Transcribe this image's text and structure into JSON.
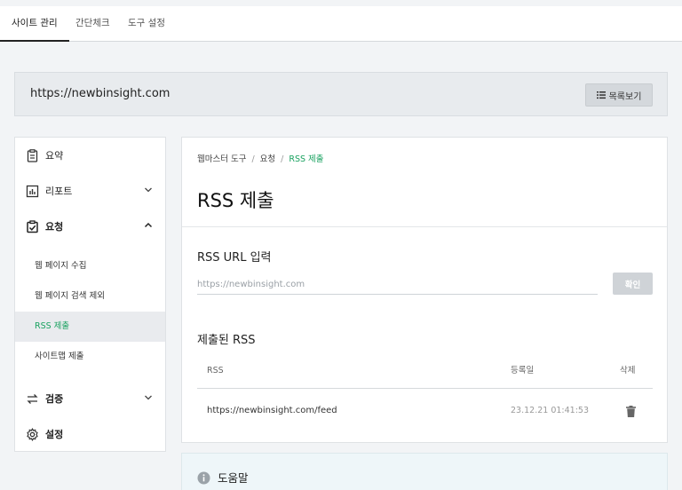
{
  "tabs": [
    {
      "label": "사이트 관리",
      "active": true
    },
    {
      "label": "간단체크",
      "active": false
    },
    {
      "label": "도구 설정",
      "active": false
    }
  ],
  "site": {
    "url": "https://newbinsight.com",
    "list_button": "목록보기"
  },
  "sidebar": {
    "items": [
      {
        "label": "요약",
        "icon": "clipboard-icon"
      },
      {
        "label": "리포트",
        "icon": "bar-chart-icon"
      },
      {
        "label": "요청",
        "icon": "clipboard-check-icon"
      },
      {
        "label": "검증",
        "icon": "exchange-icon"
      },
      {
        "label": "설정",
        "icon": "gear-icon"
      }
    ],
    "subitems": [
      {
        "label": "웹 페이지 수집"
      },
      {
        "label": "웹 페이지 검색 제외"
      },
      {
        "label": "RSS 제출",
        "active": true
      },
      {
        "label": "사이트맵 제출"
      }
    ]
  },
  "breadcrumb": [
    "웹마스터 도구",
    "요청",
    "RSS 제출"
  ],
  "page_title": "RSS 제출",
  "form": {
    "label": "RSS URL 입력",
    "placeholder": "https://newbinsight.com",
    "confirm": "확인"
  },
  "submitted": {
    "title": "제출된 RSS",
    "headers": {
      "rss": "RSS",
      "date": "등록일",
      "delete": "삭제"
    },
    "rows": [
      {
        "rss": "https://newbinsight.com/feed",
        "date": "23.12.21 01:41:53"
      }
    ]
  },
  "help": {
    "title": "도움말"
  },
  "colors": {
    "accent": "#1aa260",
    "panel_bg": "#ffffff",
    "page_bg": "#f2f4f6"
  }
}
